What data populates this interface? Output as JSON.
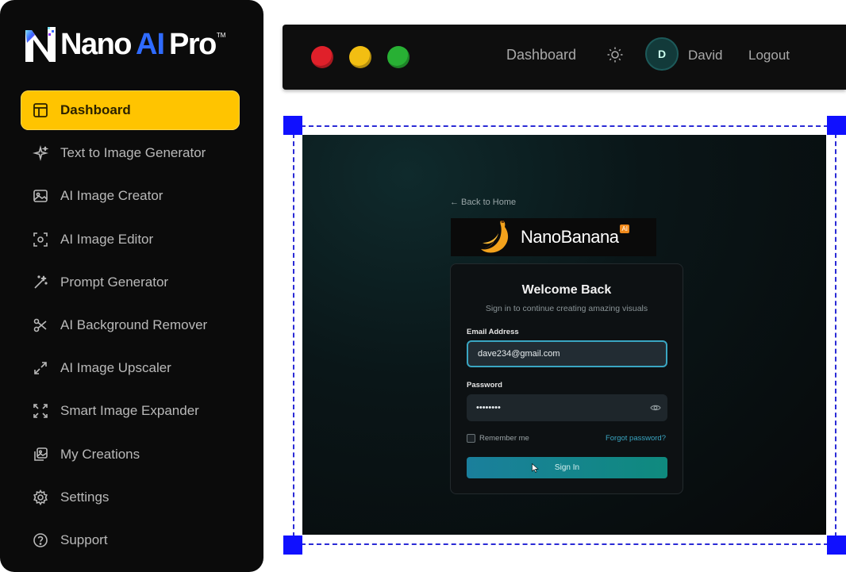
{
  "brand": {
    "nano": "Nano",
    "ai": "AI",
    "pro": "Pro",
    "tm": "TM"
  },
  "sidebar": {
    "items": [
      {
        "label": "Dashboard",
        "icon": "layout-icon",
        "active": true
      },
      {
        "label": "Text to Image Generator",
        "icon": "sparkles-icon"
      },
      {
        "label": "AI Image Creator",
        "icon": "image-icon"
      },
      {
        "label": "AI Image Editor",
        "icon": "scan-icon"
      },
      {
        "label": "Prompt Generator",
        "icon": "magic-wand-icon"
      },
      {
        "label": "AI Background Remover",
        "icon": "scissors-icon"
      },
      {
        "label": "AI Image Upscaler",
        "icon": "expand-icon"
      },
      {
        "label": "Smart Image Expander",
        "icon": "maximize-icon"
      },
      {
        "label": "My Creations",
        "icon": "gallery-icon"
      },
      {
        "label": "Settings",
        "icon": "gear-icon"
      },
      {
        "label": "Support",
        "icon": "help-icon"
      }
    ]
  },
  "topbar": {
    "dashboard": "Dashboard",
    "avatar_initial": "D",
    "user": "David",
    "logout": "Logout"
  },
  "screen": {
    "back": "← Back to Home",
    "brand_text": "NanoBanana",
    "brand_badge": "AI",
    "title": "Welcome Back",
    "subtitle": "Sign in to continue creating amazing visuals",
    "email_label": "Email Address",
    "email_value": "dave234@gmail.com",
    "password_label": "Password",
    "password_value": "••••••••",
    "remember": "Remember me",
    "forgot": "Forgot password?",
    "signin": "Sign In"
  },
  "colors": {
    "accent": "#ffc400",
    "selection": "#1010ff",
    "teal": "#3aa6c2"
  }
}
